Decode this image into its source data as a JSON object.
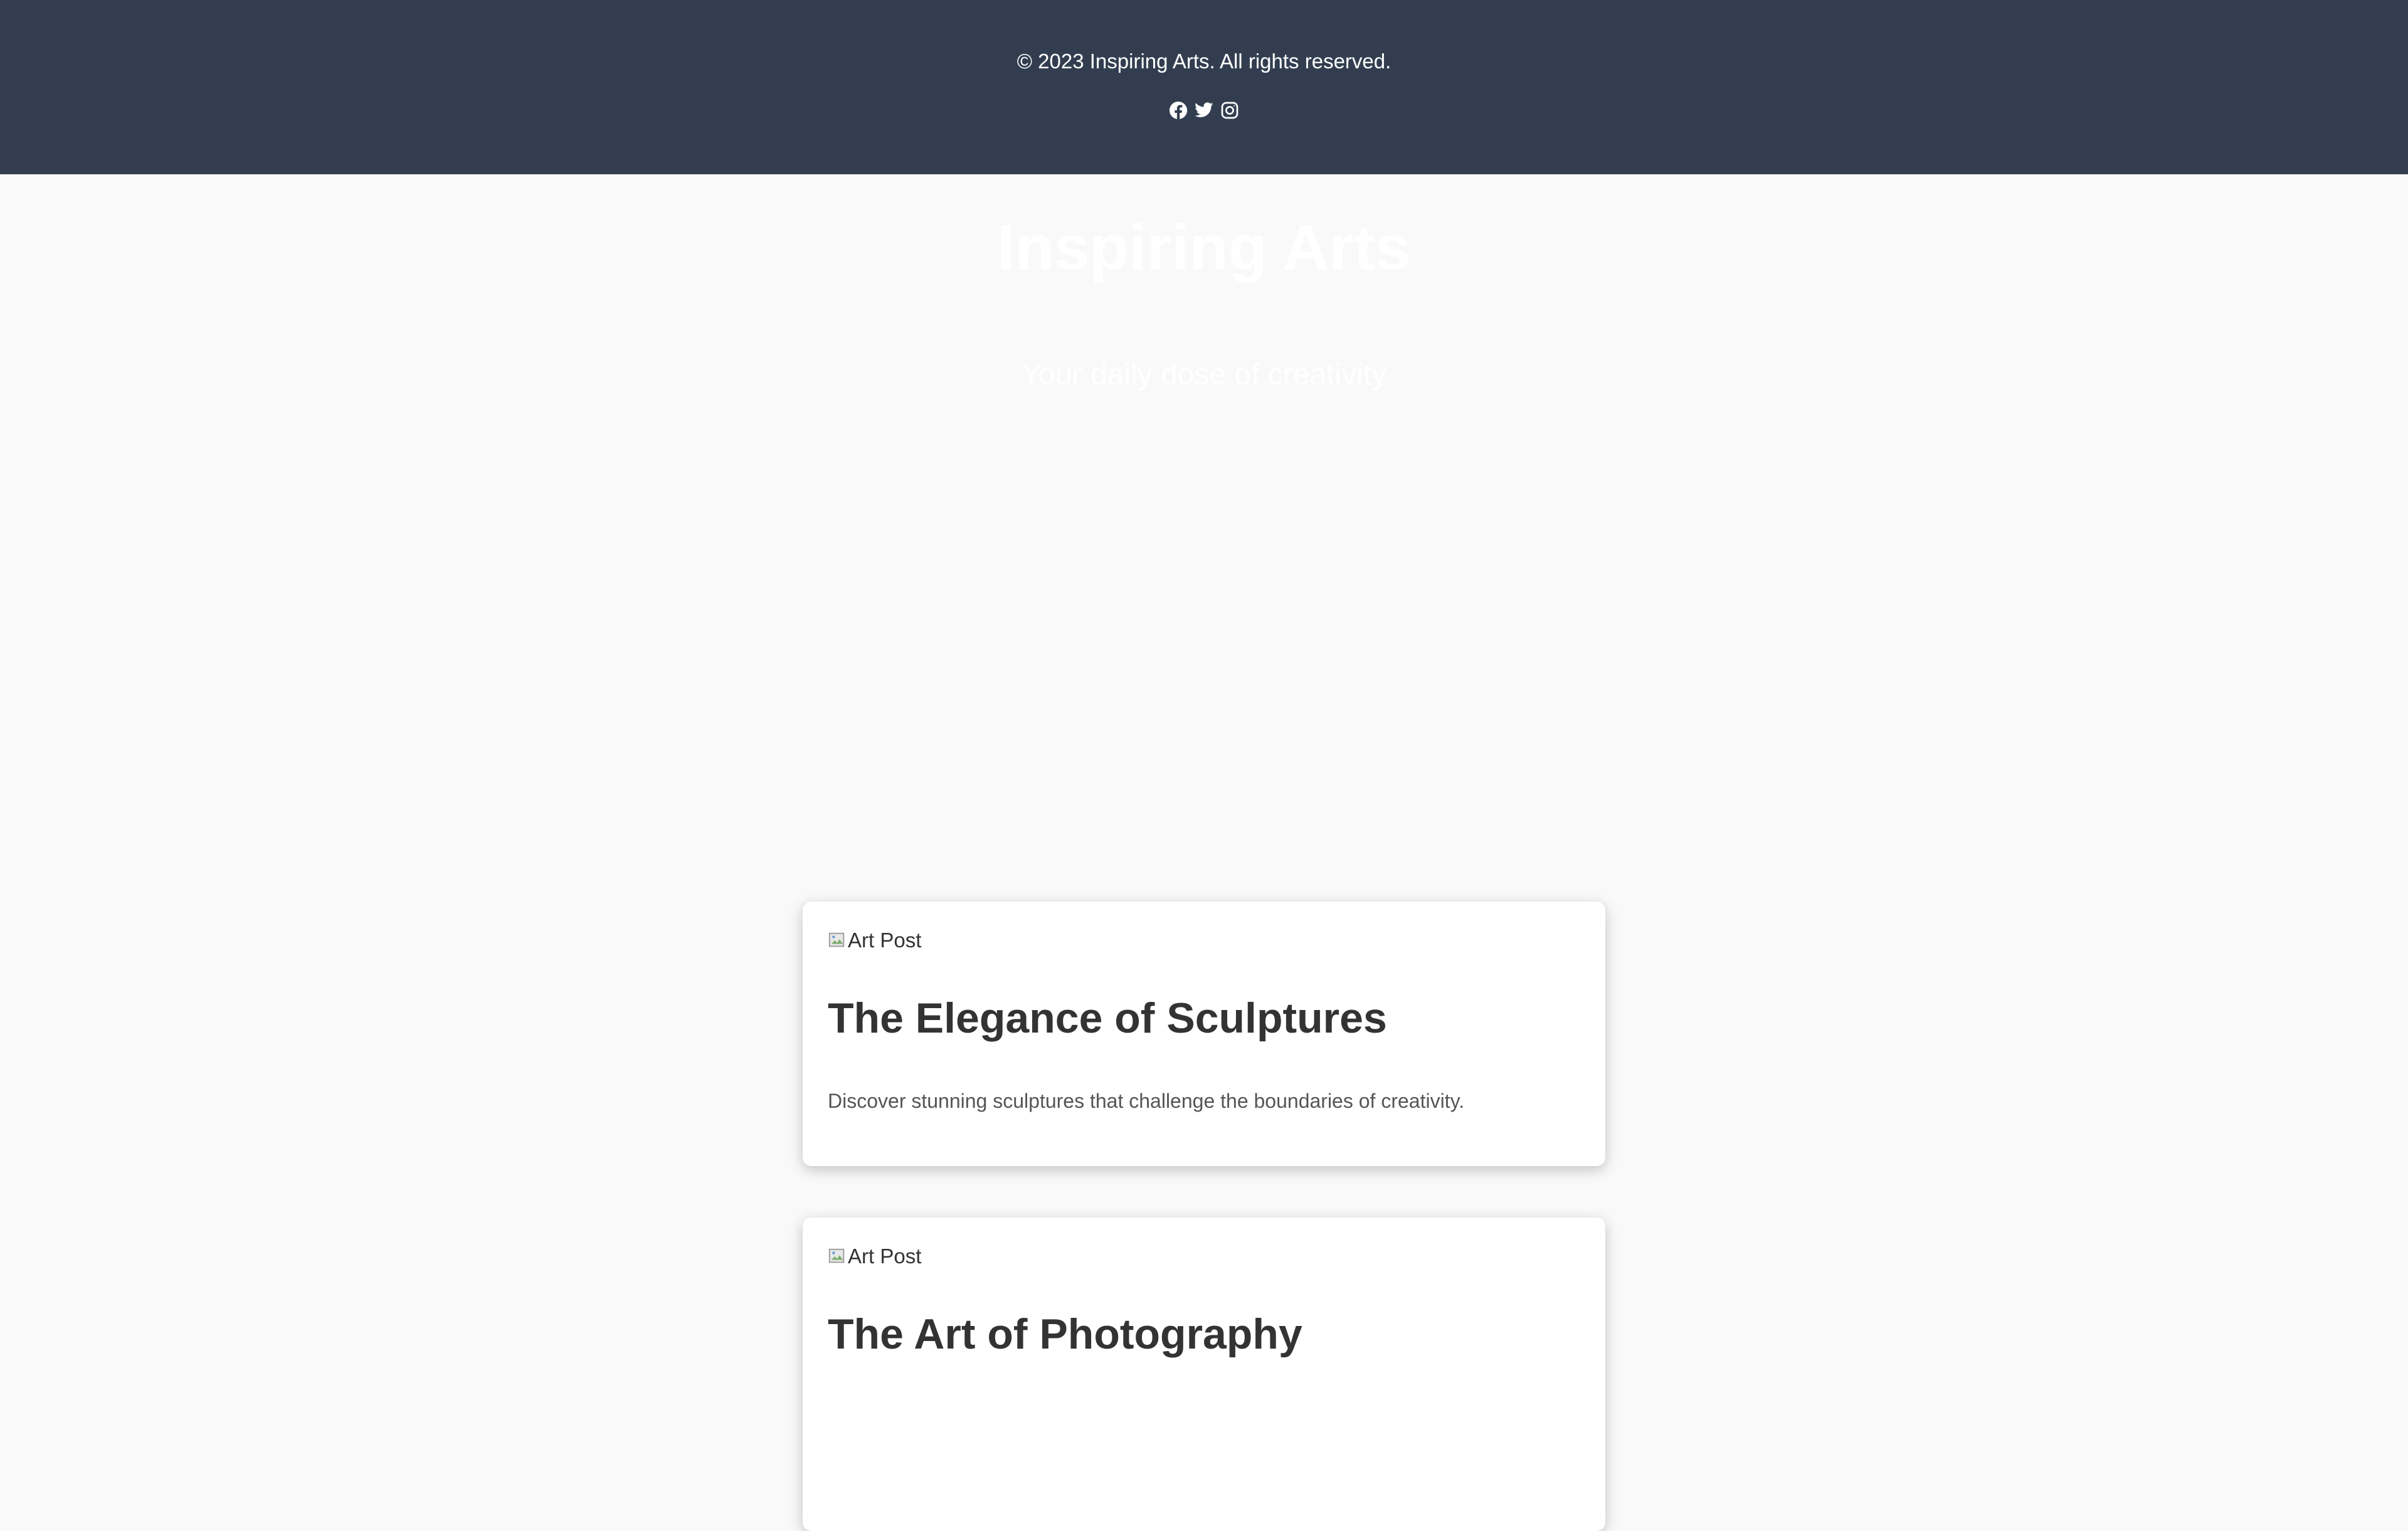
{
  "footer": {
    "copyright": "© 2023 Inspiring Arts. All rights reserved.",
    "social": [
      {
        "icon": "facebook-icon",
        "label": "Facebook"
      },
      {
        "icon": "twitter-icon",
        "label": "Twitter"
      },
      {
        "icon": "instagram-icon",
        "label": "Instagram"
      }
    ]
  },
  "hero": {
    "title": "Inspiring Arts",
    "subtitle": "Your daily dose of creativity"
  },
  "posts": [
    {
      "image_alt": "Art Post",
      "title": "The Elegance of Sculptures",
      "excerpt": "Discover stunning sculptures that challenge the boundaries of creativity."
    },
    {
      "image_alt": "Art Post",
      "title": "The Art of Photography"
    }
  ],
  "colors": {
    "top_bar": "#323e50",
    "page_background": "#f9f9f9",
    "card_background": "#ffffff",
    "text_dark": "#333333"
  }
}
